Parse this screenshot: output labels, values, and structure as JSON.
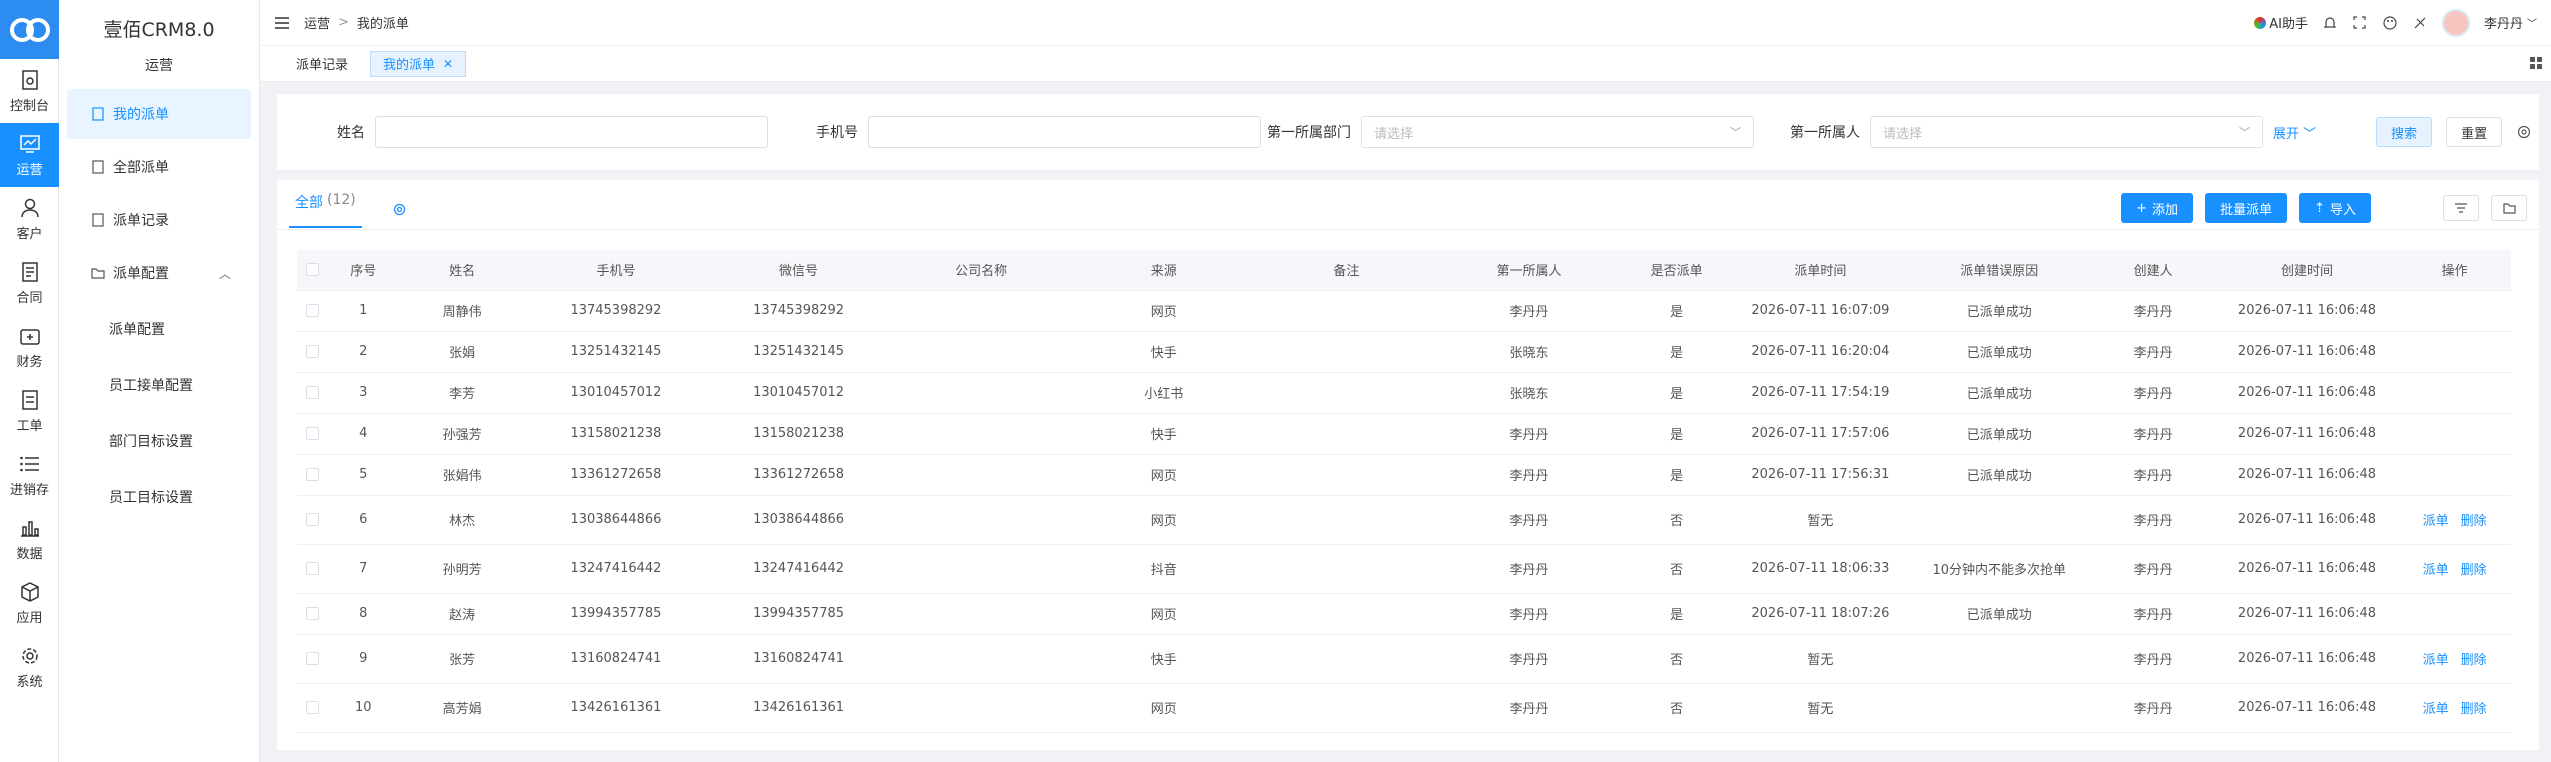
{
  "app": {
    "title": "壹佰CRM8.0",
    "section": "运营"
  },
  "rail": [
    {
      "label": "控制台",
      "icon": "dashboard-icon"
    },
    {
      "label": "运营",
      "icon": "chart-icon",
      "active": true
    },
    {
      "label": "客户",
      "icon": "user-icon"
    },
    {
      "label": "合同",
      "icon": "contract-icon"
    },
    {
      "label": "财务",
      "icon": "wallet-icon"
    },
    {
      "label": "工单",
      "icon": "ticket-icon"
    },
    {
      "label": "进销存",
      "icon": "list-icon"
    },
    {
      "label": "数据",
      "icon": "bar-chart-icon"
    },
    {
      "label": "应用",
      "icon": "cube-icon"
    },
    {
      "label": "系统",
      "icon": "gear-icon"
    }
  ],
  "submenu": {
    "items": [
      "我的派单",
      "全部派单",
      "派单记录",
      "派单配置"
    ],
    "children": [
      "派单配置",
      "员工接单配置",
      "部门目标设置",
      "员工目标设置"
    ]
  },
  "header": {
    "breadcrumb": [
      "运营",
      "我的派单"
    ],
    "ai_label": "AI助手",
    "user": "李丹丹"
  },
  "tabs": [
    "派单记录",
    "我的派单"
  ],
  "filters": {
    "name_label": "姓名",
    "name_value": "",
    "phone_label": "手机号",
    "phone_value": "",
    "dept_label": "第一所属部门",
    "dept_placeholder": "请选择",
    "owner_label": "第一所属人",
    "owner_placeholder": "请选择",
    "expand": "展开",
    "search": "搜索",
    "reset": "重置"
  },
  "list": {
    "tab_label": "全部",
    "count": "(12)",
    "add": "添加",
    "batch": "批量派单",
    "import": "导入"
  },
  "table": {
    "headers": [
      "序号",
      "姓名",
      "手机号",
      "微信号",
      "公司名称",
      "来源",
      "备注",
      "第一所属人",
      "是否派单",
      "派单时间",
      "派单错误原因",
      "创建人",
      "创建时间",
      "操作"
    ],
    "op_dispatch": "派单",
    "op_delete": "删除",
    "rows": [
      [
        "1",
        "周静伟",
        "13745398292",
        "13745398292",
        "",
        "网页",
        "",
        "李丹丹",
        "是",
        "2026-07-11 16:07:09",
        "已派单成功",
        "李丹丹",
        "2026-07-11 16:06:48",
        ""
      ],
      [
        "2",
        "张娟",
        "13251432145",
        "13251432145",
        "",
        "快手",
        "",
        "张晓东",
        "是",
        "2026-07-11 16:20:04",
        "已派单成功",
        "李丹丹",
        "2026-07-11 16:06:48",
        ""
      ],
      [
        "3",
        "李芳",
        "13010457012",
        "13010457012",
        "",
        "小红书",
        "",
        "张晓东",
        "是",
        "2026-07-11 17:54:19",
        "已派单成功",
        "李丹丹",
        "2026-07-11 16:06:48",
        ""
      ],
      [
        "4",
        "孙强芳",
        "13158021238",
        "13158021238",
        "",
        "快手",
        "",
        "李丹丹",
        "是",
        "2026-07-11 17:57:06",
        "已派单成功",
        "李丹丹",
        "2026-07-11 16:06:48",
        ""
      ],
      [
        "5",
        "张娟伟",
        "13361272658",
        "13361272658",
        "",
        "网页",
        "",
        "李丹丹",
        "是",
        "2026-07-11 17:56:31",
        "已派单成功",
        "李丹丹",
        "2026-07-11 16:06:48",
        ""
      ],
      [
        "6",
        "林杰",
        "13038644866",
        "13038644866",
        "",
        "网页",
        "",
        "李丹丹",
        "否",
        "暂无",
        "",
        "李丹丹",
        "2026-07-11 16:06:48",
        "op"
      ],
      [
        "7",
        "孙明芳",
        "13247416442",
        "13247416442",
        "",
        "抖音",
        "",
        "李丹丹",
        "否",
        "2026-07-11 18:06:33",
        "10分钟内不能多次抢单",
        "李丹丹",
        "2026-07-11 16:06:48",
        "op"
      ],
      [
        "8",
        "赵涛",
        "13994357785",
        "13994357785",
        "",
        "网页",
        "",
        "李丹丹",
        "是",
        "2026-07-11 18:07:26",
        "已派单成功",
        "李丹丹",
        "2026-07-11 16:06:48",
        ""
      ],
      [
        "9",
        "张芳",
        "13160824741",
        "13160824741",
        "",
        "快手",
        "",
        "李丹丹",
        "否",
        "暂无",
        "",
        "李丹丹",
        "2026-07-11 16:06:48",
        "op"
      ],
      [
        "10",
        "高芳娟",
        "13426161361",
        "13426161361",
        "",
        "网页",
        "",
        "李丹丹",
        "否",
        "暂无",
        "",
        "李丹丹",
        "2026-07-11 16:06:48",
        "op"
      ]
    ]
  },
  "colors": {
    "primary": "#1890ff",
    "rail_active": "#1890ff"
  }
}
